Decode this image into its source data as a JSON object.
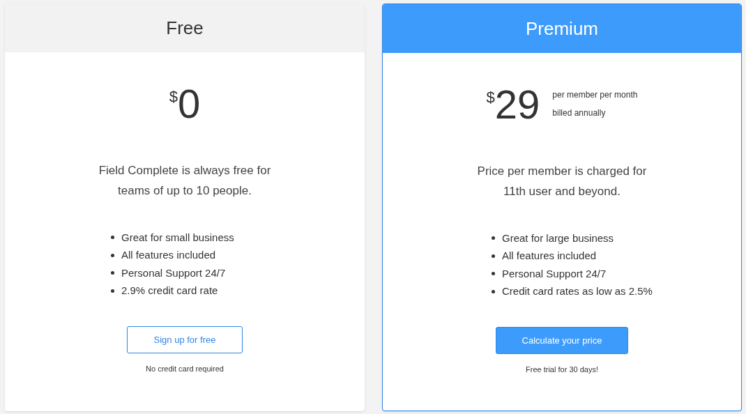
{
  "plans": [
    {
      "name": "Free",
      "featured": false,
      "currency": "$",
      "amount": "0",
      "description": "Field Complete is always free for teams of up to 10 people.",
      "features": [
        "Great for small business",
        "All features included",
        "Personal Support 24/7",
        "2.9% credit card rate"
      ],
      "button": "Sign up for free",
      "footnote": "No credit card required"
    },
    {
      "name": "Premium",
      "featured": true,
      "currency": "$",
      "amount": "29",
      "price_note": [
        "per member per month",
        "billed annually"
      ],
      "description": "Price per member is charged for 11th user and beyond.",
      "features": [
        "Great for large business",
        "All features included",
        "Personal Support 24/7",
        "Credit card rates as low as 2.5%"
      ],
      "button": "Calculate your price",
      "footnote": "Free trial for 30 days!"
    }
  ]
}
